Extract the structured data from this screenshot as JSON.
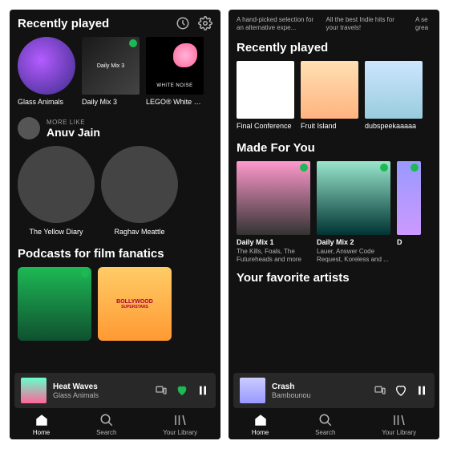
{
  "left": {
    "recently_title": "Recently played",
    "tiles": [
      {
        "label": "Glass Animals"
      },
      {
        "label": "Daily Mix 3",
        "inner": "Daily Mix 3"
      },
      {
        "label": "LEGO® White Noise",
        "inner": "WHITE NOISE"
      }
    ],
    "more_like_label": "MORE LIKE",
    "more_like_artist": "Anuv Jain",
    "circles": [
      {
        "label": "The Yellow Diary"
      },
      {
        "label": "Raghav Meattle"
      }
    ],
    "podcasts_title": "Podcasts for film fanatics",
    "pod2_text": "BOLLYWOOD",
    "pod2_sub": "SUPERSTARS",
    "player": {
      "title": "Heat Waves",
      "artist": "Glass Animals"
    },
    "tabs": [
      {
        "label": "Home"
      },
      {
        "label": "Search"
      },
      {
        "label": "Your Library"
      }
    ]
  },
  "right": {
    "blurbs": [
      "A hand-picked selection for an alternative expe...",
      "All the best Indie hits for your travels!",
      "A se\ngrea"
    ],
    "recently_title": "Recently played",
    "tiles": [
      {
        "label": "Final Conference"
      },
      {
        "label": "Fruit Island"
      },
      {
        "label": "dubspeekaaaaa"
      }
    ],
    "made_title": "Made For You",
    "mixes": [
      {
        "label": "Daily Mix 1",
        "sub": "The Kills, Foals, The Futureheads and more"
      },
      {
        "label": "Daily Mix 2",
        "sub": "Lauer, Answer Code Request, Koreless and ..."
      },
      {
        "label": "D",
        "sub": ""
      }
    ],
    "fav_title": "Your favorite artists",
    "player": {
      "title": "Crash",
      "artist": "Bambounou"
    },
    "tabs": [
      {
        "label": "Home"
      },
      {
        "label": "Search"
      },
      {
        "label": "Your Library"
      }
    ]
  }
}
